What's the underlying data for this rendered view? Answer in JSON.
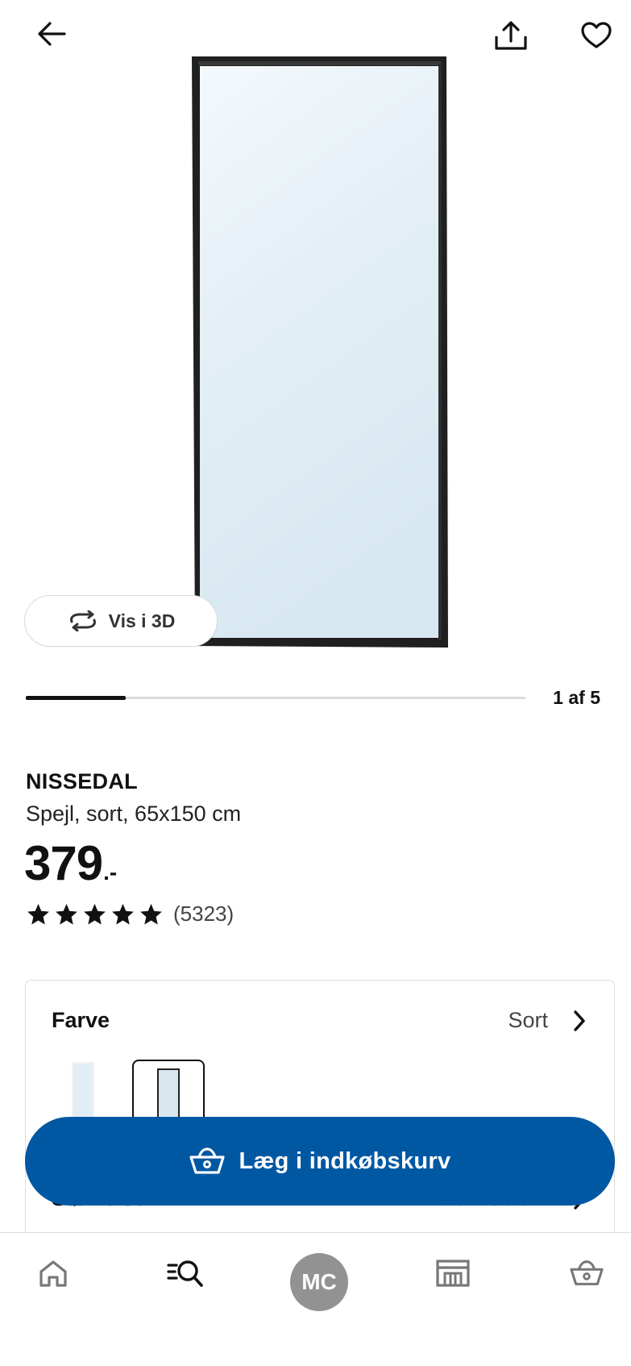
{
  "header": {
    "back_icon": "arrow-left-icon",
    "share_icon": "share-icon",
    "favorite_icon": "heart-icon"
  },
  "gallery": {
    "view_3d_label": "Vis i 3D",
    "page_counter": "1 af 5",
    "current_page": 1,
    "total_pages": 5,
    "progress_fraction": 0.2
  },
  "product": {
    "name": "NISSEDAL",
    "description": "Spejl, sort, 65x150 cm",
    "price": "379",
    "price_suffix": ".-",
    "rating_stars": 5,
    "review_count": "(5323)"
  },
  "options": {
    "color_label": "Farve",
    "color_value": "Sort",
    "size_label": "Størrelse",
    "size_value": "65x150 cm"
  },
  "cta": {
    "add_to_cart_label": "Læg i indkøbskurv"
  },
  "bottom_nav": {
    "profile_initials": "MC",
    "items": [
      "home-icon",
      "search-icon",
      "profile-avatar",
      "store-icon",
      "cart-icon"
    ]
  },
  "colors": {
    "primary_blue": "#0058a3",
    "avatar_gray": "#929292"
  }
}
